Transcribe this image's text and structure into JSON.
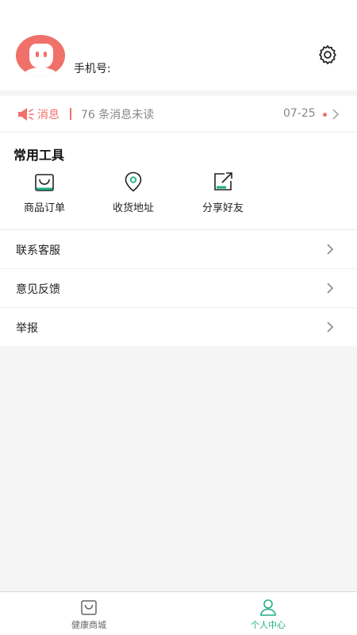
{
  "profile": {
    "phone_label": "手机号:",
    "avatar_color": "#f0706a"
  },
  "header": {
    "settings_icon": "gear-icon"
  },
  "notice": {
    "tag": "消息",
    "unread_text": "76 条消息未读",
    "date": "07-25",
    "accent": "#f0706a"
  },
  "tools": {
    "title": "常用工具",
    "items": [
      {
        "label": "商品订单",
        "icon": "shopping-bag-icon"
      },
      {
        "label": "收货地址",
        "icon": "location-pin-icon"
      },
      {
        "label": "分享好友",
        "icon": "share-icon"
      }
    ]
  },
  "menu": {
    "items": [
      {
        "label": "联系客服"
      },
      {
        "label": "意见反馈"
      },
      {
        "label": "举报"
      }
    ]
  },
  "tabbar": {
    "items": [
      {
        "label": "健康商城",
        "icon": "shopping-bag-icon",
        "active": false
      },
      {
        "label": "个人中心",
        "icon": "person-icon",
        "active": true
      }
    ],
    "active_color": "#1fae85"
  }
}
